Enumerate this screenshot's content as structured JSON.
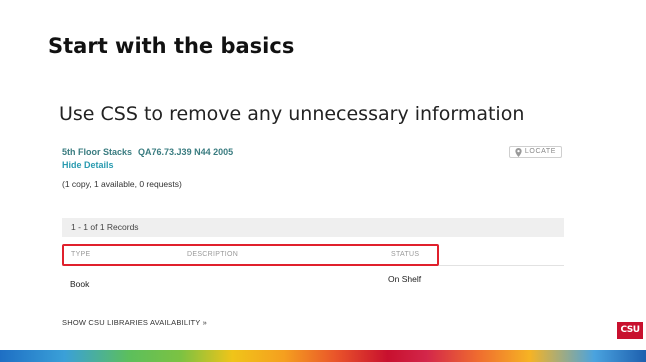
{
  "slide": {
    "title": "Start with the basics",
    "subtitle": "Use CSS to remove any unnecessary information"
  },
  "holding": {
    "location": "5th Floor Stacks",
    "call_number": "QA76.73.J39 N44 2005",
    "hide_details_label": "Hide Details",
    "copy_summary": "(1 copy, 1 available, 0 requests)",
    "locate_label": "LOCATE",
    "records_label": "1 - 1 of 1 Records",
    "columns": {
      "type": "TYPE",
      "description": "DESCRIPTION",
      "status": "STATUS"
    },
    "rows": [
      {
        "type": "Book",
        "description": "",
        "status": "On Shelf"
      }
    ],
    "show_availability_label": "SHOW CSU LIBRARIES AVAILABILITY »"
  },
  "logo": {
    "text": "CSU"
  },
  "colors": {
    "highlight": "#e0202c",
    "link": "#2a9bb0",
    "logo_bg": "#c8102e"
  }
}
